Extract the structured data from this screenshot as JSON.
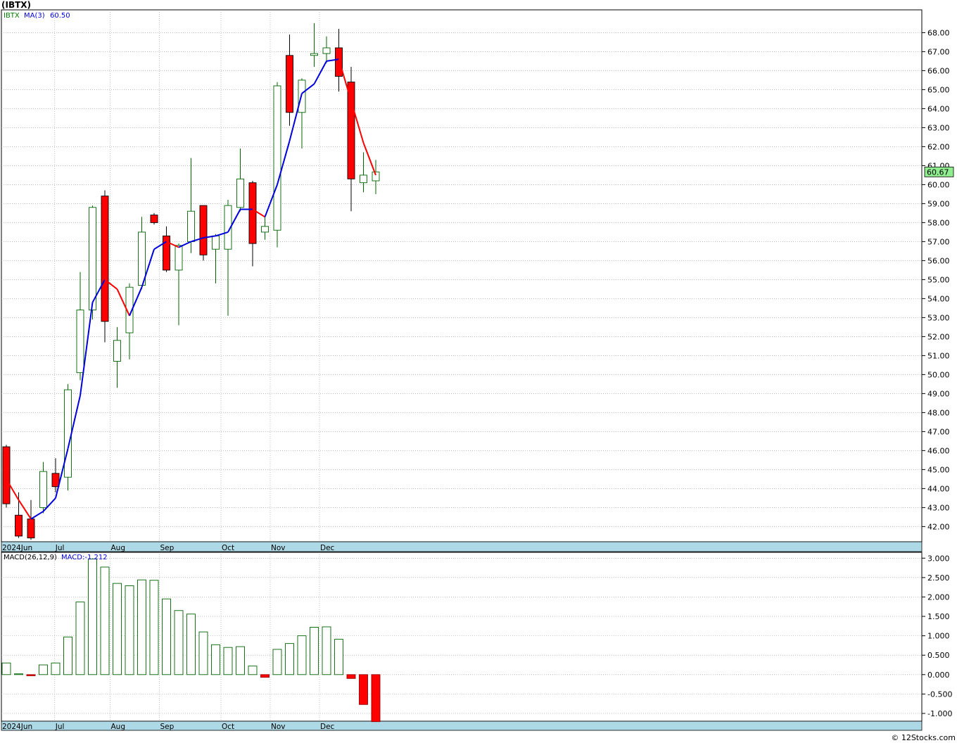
{
  "header": {
    "title": "(IBTX)"
  },
  "credit": "© 12Stocks.com",
  "price_panel": {
    "symbol": "IBTX",
    "ma_label": "MA(3)",
    "ma_value": "60.50",
    "last_price": "60.67",
    "y_ticks": [
      "42.00",
      "43.00",
      "44.00",
      "45.00",
      "46.00",
      "47.00",
      "48.00",
      "49.00",
      "50.00",
      "51.00",
      "52.00",
      "53.00",
      "54.00",
      "55.00",
      "56.00",
      "57.00",
      "58.00",
      "59.00",
      "60.00",
      "61.00",
      "62.00",
      "63.00",
      "64.00",
      "65.00",
      "66.00",
      "67.00",
      "68.00"
    ],
    "x_labels": [
      "2024Jun",
      "Jul",
      "Aug",
      "Sep",
      "Oct",
      "Nov",
      "Dec"
    ]
  },
  "macd_panel": {
    "label": "MACD(26,12,9)",
    "value_label": "MACD:-1.212",
    "y_ticks": [
      "3.000",
      "2.500",
      "2.000",
      "1.500",
      "1.000",
      "0.500",
      "0.000",
      "-0.500",
      "-1.000"
    ],
    "x_labels": [
      "2024Jun",
      "Jul",
      "Aug",
      "Sep",
      "Oct",
      "Nov",
      "Dec"
    ]
  },
  "colors": {
    "up": "#ffffff",
    "up_stroke": "#006400",
    "down": "#ff0000",
    "down_stroke": "#000000",
    "ma_up": "#0000dd",
    "ma_down": "#ff0000",
    "axis_band": "#add8e6",
    "grid": "#9a9a9a",
    "last_price_bg": "#90ee90"
  },
  "chart_data": [
    {
      "type": "candlestick",
      "title": "(IBTX)",
      "interval": "weekly",
      "ylim": [
        41.2,
        69.2
      ],
      "grid": true,
      "x_month_labels": [
        {
          "label": "2024Jun",
          "week_index": 0
        },
        {
          "label": "Jul",
          "week_index": 4.5
        },
        {
          "label": "Aug",
          "week_index": 9
        },
        {
          "label": "Sep",
          "week_index": 13
        },
        {
          "label": "Oct",
          "week_index": 18
        },
        {
          "label": "Nov",
          "week_index": 22
        },
        {
          "label": "Dec",
          "week_index": 26
        }
      ],
      "candles": [
        {
          "o": 46.2,
          "h": 46.3,
          "l": 43.0,
          "c": 43.2
        },
        {
          "o": 42.6,
          "h": 43.8,
          "l": 41.4,
          "c": 41.5
        },
        {
          "o": 42.4,
          "h": 43.4,
          "l": 41.3,
          "c": 41.4
        },
        {
          "o": 43.0,
          "h": 45.4,
          "l": 42.7,
          "c": 44.9
        },
        {
          "o": 44.8,
          "h": 45.6,
          "l": 43.8,
          "c": 44.1
        },
        {
          "o": 44.6,
          "h": 49.5,
          "l": 43.9,
          "c": 49.2
        },
        {
          "o": 50.1,
          "h": 55.4,
          "l": 49.7,
          "c": 53.4
        },
        {
          "o": 53.4,
          "h": 58.9,
          "l": 52.9,
          "c": 58.8
        },
        {
          "o": 59.4,
          "h": 59.7,
          "l": 51.7,
          "c": 52.8
        },
        {
          "o": 50.7,
          "h": 52.5,
          "l": 49.3,
          "c": 51.8
        },
        {
          "o": 52.2,
          "h": 54.8,
          "l": 50.8,
          "c": 54.6
        },
        {
          "o": 54.7,
          "h": 58.3,
          "l": 54.5,
          "c": 57.5
        },
        {
          "o": 58.4,
          "h": 58.5,
          "l": 57.9,
          "c": 58.0
        },
        {
          "o": 57.3,
          "h": 57.8,
          "l": 55.4,
          "c": 55.5
        },
        {
          "o": 55.5,
          "h": 56.9,
          "l": 52.6,
          "c": 56.8
        },
        {
          "o": 57.0,
          "h": 61.4,
          "l": 56.4,
          "c": 58.6
        },
        {
          "o": 58.9,
          "h": 58.9,
          "l": 56.0,
          "c": 56.3
        },
        {
          "o": 56.6,
          "h": 57.4,
          "l": 54.8,
          "c": 57.3
        },
        {
          "o": 56.6,
          "h": 59.2,
          "l": 53.1,
          "c": 58.9
        },
        {
          "o": 58.8,
          "h": 61.9,
          "l": 58.6,
          "c": 60.3
        },
        {
          "o": 60.1,
          "h": 60.2,
          "l": 55.7,
          "c": 56.9
        },
        {
          "o": 57.5,
          "h": 58.3,
          "l": 57.1,
          "c": 57.8
        },
        {
          "o": 57.6,
          "h": 65.4,
          "l": 56.7,
          "c": 65.2
        },
        {
          "o": 66.8,
          "h": 67.9,
          "l": 63.1,
          "c": 63.8
        },
        {
          "o": 63.8,
          "h": 65.6,
          "l": 61.9,
          "c": 65.5
        },
        {
          "o": 66.8,
          "h": 68.5,
          "l": 66.2,
          "c": 66.9
        },
        {
          "o": 66.9,
          "h": 67.8,
          "l": 66.4,
          "c": 67.2
        },
        {
          "o": 67.2,
          "h": 68.2,
          "l": 64.9,
          "c": 65.7
        },
        {
          "o": 65.4,
          "h": 66.2,
          "l": 58.6,
          "c": 60.3
        },
        {
          "o": 60.1,
          "h": 61.7,
          "l": 59.6,
          "c": 60.5
        },
        {
          "o": 60.2,
          "h": 61.3,
          "l": 59.5,
          "c": 60.67
        }
      ],
      "ma3": [
        44.5,
        43.4,
        42.4,
        42.8,
        43.5,
        46.1,
        48.9,
        53.8,
        55.0,
        54.5,
        53.1,
        54.6,
        56.6,
        57.0,
        56.7,
        57.0,
        57.2,
        57.3,
        57.5,
        58.7,
        58.7,
        58.3,
        60.0,
        62.3,
        64.8,
        65.3,
        66.5,
        66.6,
        64.4,
        62.2,
        60.5
      ]
    },
    {
      "type": "bar",
      "title": "MACD(26,12,9)",
      "ylim": [
        -1.2,
        3.15
      ],
      "grid": true,
      "values": [
        0.3,
        0.02,
        -0.03,
        0.25,
        0.3,
        0.97,
        1.87,
        2.98,
        2.77,
        2.35,
        2.29,
        2.44,
        2.43,
        1.95,
        1.65,
        1.56,
        1.1,
        0.77,
        0.7,
        0.72,
        0.22,
        -0.07,
        0.65,
        0.8,
        1.0,
        1.22,
        1.23,
        0.91,
        -0.1,
        -0.77,
        -1.212
      ]
    }
  ]
}
